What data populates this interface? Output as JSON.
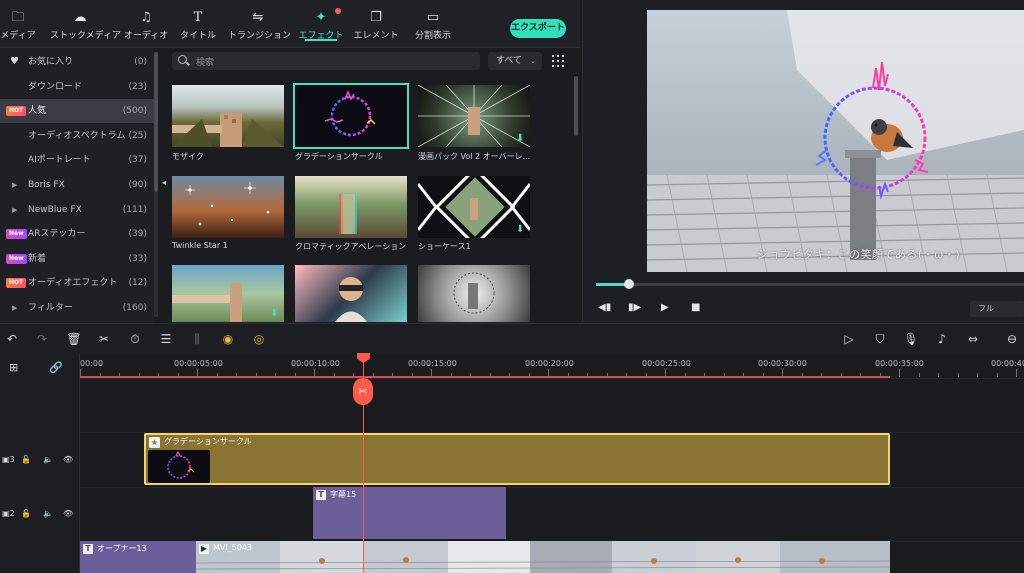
{
  "toolbar": {
    "items": [
      {
        "label": "メディア",
        "icon": "folder-icon"
      },
      {
        "label": "ストックメディア",
        "icon": "cloud-icon"
      },
      {
        "label": "オーディオ",
        "icon": "music-note-icon"
      },
      {
        "label": "タイトル",
        "icon": "text-icon"
      },
      {
        "label": "トランジション",
        "icon": "transition-icon"
      },
      {
        "label": "エフェクト",
        "icon": "sparkle-icon"
      },
      {
        "label": "エレメント",
        "icon": "elements-icon"
      },
      {
        "label": "分割表示",
        "icon": "split-screen-icon"
      }
    ],
    "active_index": 5,
    "export_label": "エクスポート"
  },
  "sidebar": {
    "items": [
      {
        "label": "お気に入り",
        "count": "(0)",
        "badge": "",
        "chevron": false,
        "heart": true
      },
      {
        "label": "ダウンロード",
        "count": "(23)",
        "badge": "",
        "chevron": false,
        "heart": false
      },
      {
        "label": "人気",
        "count": "(500)",
        "badge": "HOT",
        "chevron": false,
        "heart": false
      },
      {
        "label": "オーディオスペクトラム",
        "count": "(25)",
        "badge": "",
        "chevron": false,
        "heart": false
      },
      {
        "label": "AIポートレート",
        "count": "(37)",
        "badge": "",
        "chevron": false,
        "heart": false
      },
      {
        "label": "Boris FX",
        "count": "(90)",
        "badge": "",
        "chevron": true,
        "heart": false
      },
      {
        "label": "NewBlue FX",
        "count": "(111)",
        "badge": "",
        "chevron": true,
        "heart": false
      },
      {
        "label": "ARステッカー",
        "count": "(39)",
        "badge": "New",
        "chevron": false,
        "heart": false
      },
      {
        "label": "新着",
        "count": "(33)",
        "badge": "New",
        "chevron": false,
        "heart": false
      },
      {
        "label": "オーディオエフェクト",
        "count": "(12)",
        "badge": "HOT",
        "chevron": false,
        "heart": false
      },
      {
        "label": "フィルター",
        "count": "(160)",
        "badge": "",
        "chevron": true,
        "heart": false
      }
    ],
    "selected_index": 2
  },
  "effects": {
    "search_placeholder": "検索",
    "filter_value": "すべて",
    "items": [
      {
        "label": "モザイク"
      },
      {
        "label": "グラデーションサークル"
      },
      {
        "label": "漫画パック Vol 2 オーバーレ..."
      },
      {
        "label": "Twinkle Star 1"
      },
      {
        "label": "クロマティックアベレーション"
      },
      {
        "label": "ショーケース1"
      },
      {
        "label": ""
      },
      {
        "label": ""
      },
      {
        "label": ""
      }
    ],
    "selected_index": 1
  },
  "preview": {
    "subtitle": "ジョウビタキ：この笑顔である(・ω・)",
    "quality": "フル",
    "progress": 0.07
  },
  "timeline": {
    "ruler": [
      "00:00",
      "00:00:05:00",
      "00:00:10:00",
      "00:00:15:00",
      "00:00:20:00",
      "00:00:25:00",
      "00:00:30:00",
      "00:00:35:00",
      "00:00:40:0"
    ],
    "tracks": [
      {
        "num": "3"
      },
      {
        "num": "2"
      }
    ],
    "clips": {
      "effect": "グラデーションサークル",
      "title": "字幕15",
      "opener": "オープナー13",
      "video": "MVI_5043"
    }
  },
  "colors": {
    "accent": "#48e0c0",
    "playhead": "#ff5b4d",
    "effect_clip": "#8a7433",
    "title_clip": "#6b5f99"
  }
}
